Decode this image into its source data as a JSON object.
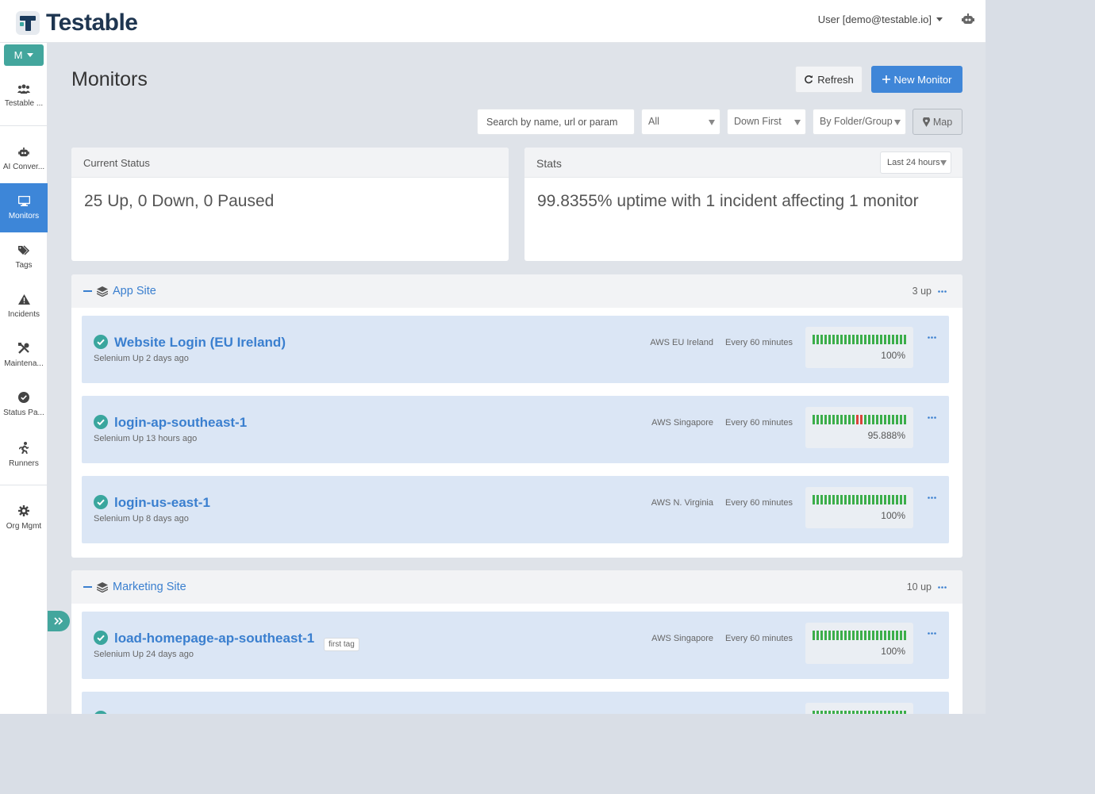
{
  "app": {
    "logo_text": "Testable",
    "user": "User [demo@testable.io]"
  },
  "sidebar": {
    "org_button": "M",
    "items": [
      {
        "label": "Testable ...",
        "icon": "users-icon"
      },
      {
        "label": "AI Conver...",
        "icon": "robot-icon"
      },
      {
        "label": "Monitors",
        "icon": "desktop-icon",
        "active": true
      },
      {
        "label": "Tags",
        "icon": "tags-icon"
      },
      {
        "label": "Incidents",
        "icon": "warning-icon"
      },
      {
        "label": "Maintena...",
        "icon": "tools-icon"
      },
      {
        "label": "Status Pa...",
        "icon": "check-circle-icon"
      },
      {
        "label": "Runners",
        "icon": "runner-icon"
      },
      {
        "label": "Org Mgmt",
        "icon": "gear-icon"
      }
    ]
  },
  "page": {
    "title": "Monitors",
    "refresh_label": "Refresh",
    "new_monitor_label": "New Monitor",
    "search_placeholder": "Search by name, url or param",
    "filter_status": "All",
    "sort_order": "Down First",
    "grouping": "By Folder/Group",
    "map_label": "Map"
  },
  "current_status": {
    "title": "Current Status",
    "text": "25 Up, 0 Down, 0 Paused"
  },
  "stats": {
    "title": "Stats",
    "range": "Last 24 hours",
    "text": "99.8355% uptime with 1 incident affecting 1 monitor"
  },
  "groups": [
    {
      "name": "App Site",
      "count": "3 up",
      "monitors": [
        {
          "name": "Website Login (EU Ireland)",
          "sub": "Selenium Up 2 days ago",
          "region": "AWS EU Ireland",
          "frequency": "Every 60 minutes",
          "uptime": "100%",
          "bad_bars": []
        },
        {
          "name": "login-ap-southeast-1",
          "sub": "Selenium Up 13 hours ago",
          "region": "AWS Singapore",
          "frequency": "Every 60 minutes",
          "uptime": "95.888%",
          "bad_bars": [
            11,
            12
          ]
        },
        {
          "name": "login-us-east-1",
          "sub": "Selenium Up 8 days ago",
          "region": "AWS N. Virginia",
          "frequency": "Every 60 minutes",
          "uptime": "100%",
          "bad_bars": []
        }
      ]
    },
    {
      "name": "Marketing Site",
      "count": "10 up",
      "monitors": [
        {
          "name": "load-homepage-ap-southeast-1",
          "sub": "Selenium Up 24 days ago",
          "tag": "first tag",
          "region": "AWS Singapore",
          "frequency": "Every 60 minutes",
          "uptime": "100%",
          "bad_bars": []
        },
        {
          "name": "",
          "sub": "",
          "region": "",
          "frequency": "",
          "uptime": "",
          "bad_bars": []
        }
      ]
    }
  ],
  "colors": {
    "accent": "#3f86d8",
    "teal": "#43a69d",
    "up": "#3cae4a",
    "down": "#d9453a"
  }
}
